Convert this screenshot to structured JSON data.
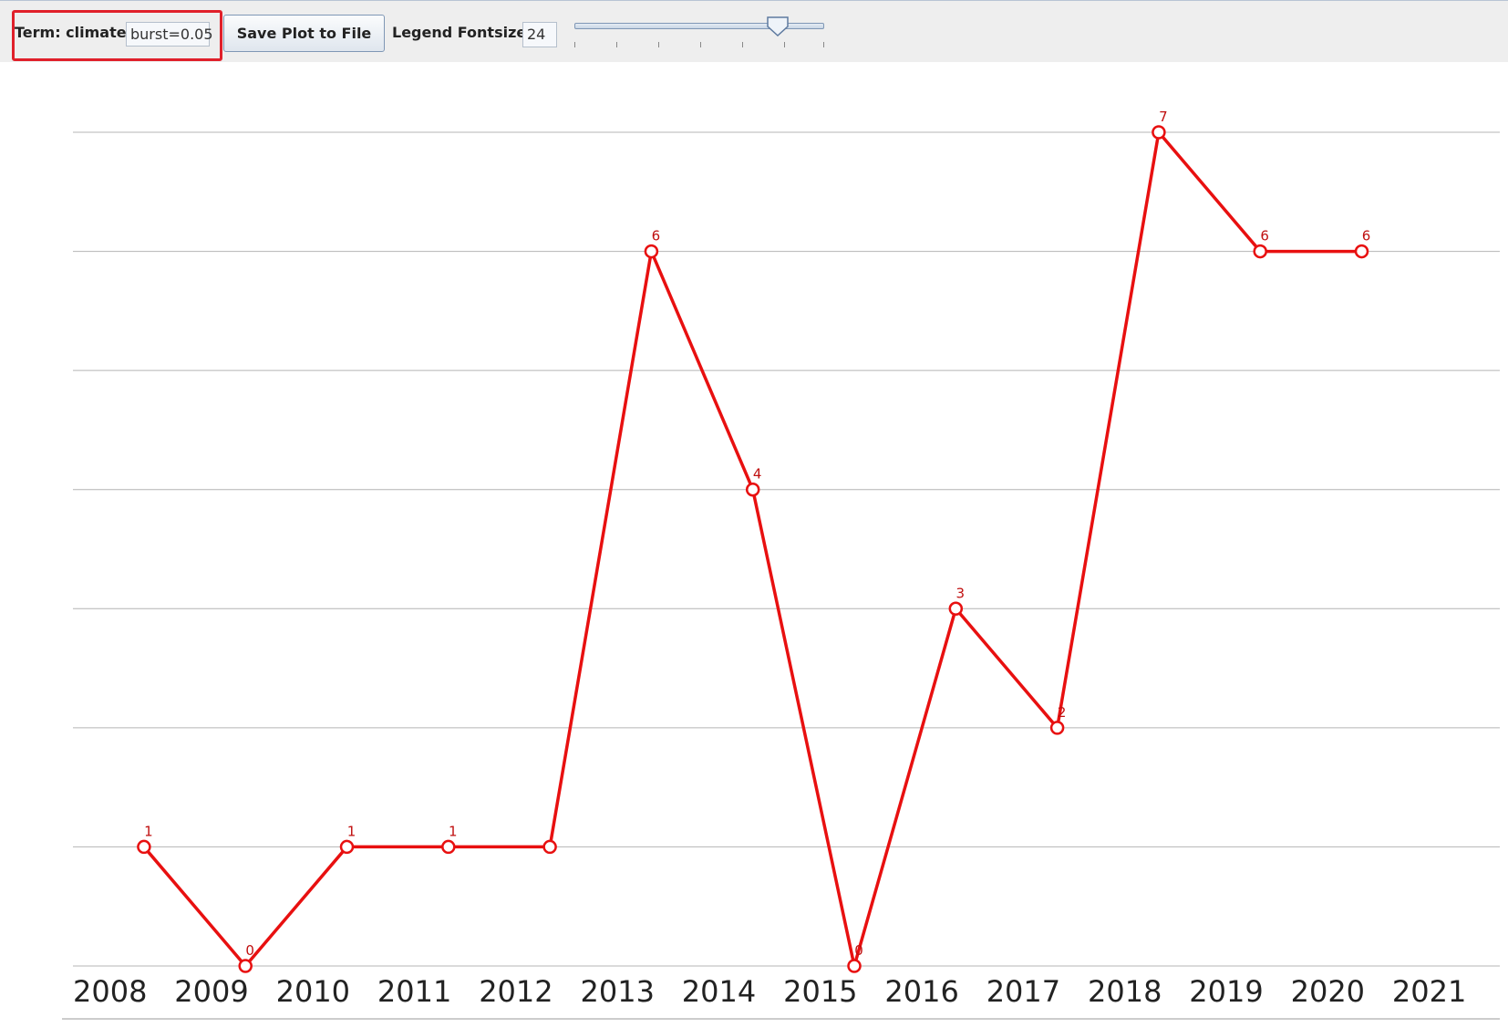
{
  "toolbar": {
    "term_label": "Term: climate",
    "burst_value": "burst=0.05",
    "save_label": "Save Plot to File",
    "legend_label": "Legend Fontsize",
    "legend_fontsize": "24",
    "slider_value": 24
  },
  "colors": {
    "line": "#e81010",
    "grid": "#b4b4b4",
    "highlight": "#e0202a"
  },
  "chart_data": {
    "type": "line",
    "title": "",
    "xlabel": "",
    "ylabel": "",
    "ylim": [
      0,
      7
    ],
    "x_tick_labels": [
      "2008",
      "2009",
      "2010",
      "2011",
      "2012",
      "2013",
      "2014",
      "2015",
      "2016",
      "2017",
      "2018",
      "2019",
      "2020",
      "2021"
    ],
    "x": [
      2008.7,
      2009.7,
      2010.7,
      2011.7,
      2012.7,
      2013.7,
      2014.7,
      2015.7,
      2016.7,
      2017.7,
      2018.7,
      2019.7,
      2020.7
    ],
    "series": [
      {
        "values": [
          1,
          0,
          1,
          1,
          1,
          6,
          4,
          0,
          3,
          2,
          7,
          6,
          6
        ],
        "point_labels": [
          "1",
          "0",
          "1",
          "1",
          "",
          "6",
          "4",
          "0",
          "3",
          "2",
          "7",
          "6",
          "6"
        ]
      }
    ],
    "grid": true
  }
}
